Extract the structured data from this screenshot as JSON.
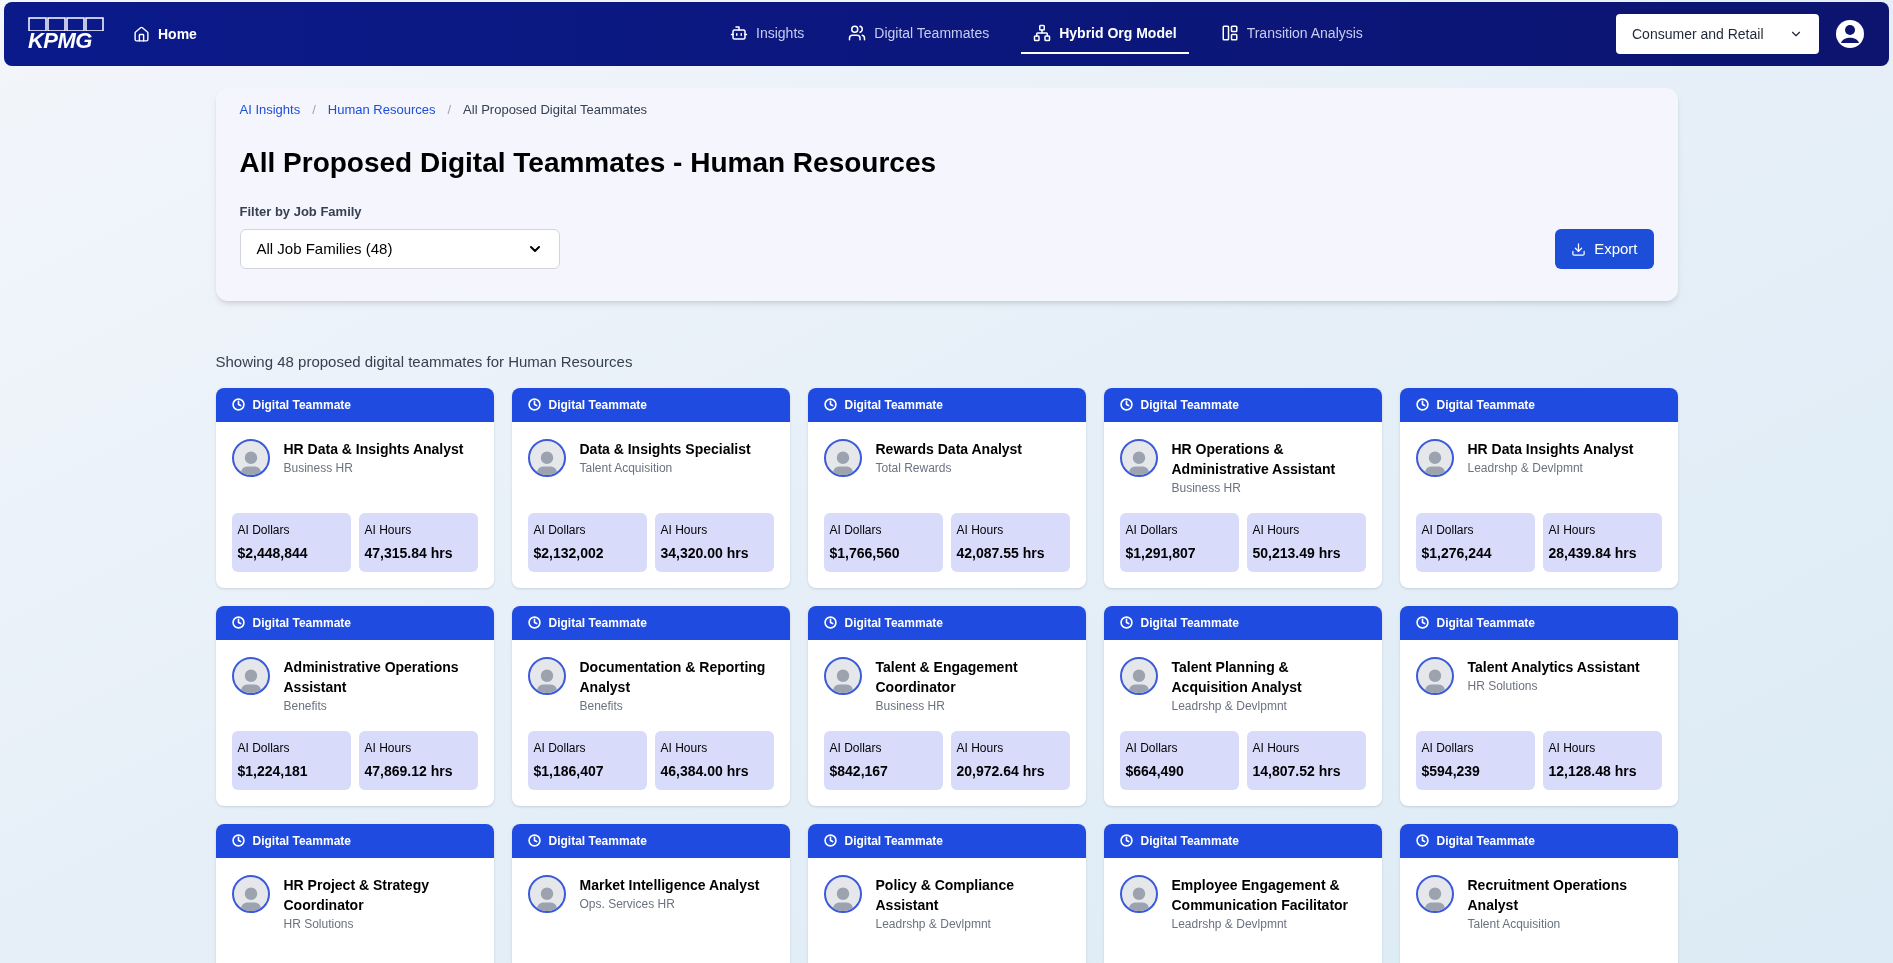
{
  "nav": {
    "logo": "KPMG",
    "home": {
      "label": "Home"
    },
    "tabs": [
      {
        "label": "Insights",
        "selected": false,
        "kind": "insights"
      },
      {
        "label": "Digital Teammates",
        "selected": false,
        "kind": "teammates"
      },
      {
        "label": "Hybrid Org Model",
        "selected": true,
        "kind": "org"
      },
      {
        "label": "Transition Analysis",
        "selected": false,
        "kind": "transition"
      }
    ],
    "industry_select": {
      "value": "Consumer and Retail"
    }
  },
  "breadcrumb": [
    {
      "label": "AI Insights",
      "kind": "link"
    },
    {
      "separator": "/",
      "label": "Human Resources",
      "kind": "link"
    },
    {
      "separator": "/",
      "label": "All Proposed Digital Teammates",
      "kind": "current"
    }
  ],
  "title": "All Proposed Digital Teammates - Human Resources",
  "filter": {
    "label": "Filter by Job Family",
    "value": "All Job Families (48)"
  },
  "export_button": "Export",
  "summary": "Showing 48 proposed digital teammates for Human Resources",
  "cards": [
    {
      "badge": "Digital Teammate",
      "title": "HR Data & Insights Analyst",
      "subtitle": "Business HR",
      "stats": [
        {
          "label": "AI Dollars",
          "value": "$2,448,844"
        },
        {
          "label": "AI Hours",
          "value": "47,315.84 hrs"
        }
      ]
    },
    {
      "badge": "Digital Teammate",
      "title": "Data & Insights Specialist",
      "subtitle": "Talent Acquisition",
      "stats": [
        {
          "label": "AI Dollars",
          "value": "$2,132,002"
        },
        {
          "label": "AI Hours",
          "value": "34,320.00 hrs"
        }
      ]
    },
    {
      "badge": "Digital Teammate",
      "title": "Rewards Data Analyst",
      "subtitle": "Total Rewards",
      "stats": [
        {
          "label": "AI Dollars",
          "value": "$1,766,560"
        },
        {
          "label": "AI Hours",
          "value": "42,087.55 hrs"
        }
      ]
    },
    {
      "badge": "Digital Teammate",
      "title": "HR Operations & Administrative Assistant",
      "subtitle": "Business HR",
      "stats": [
        {
          "label": "AI Dollars",
          "value": "$1,291,807"
        },
        {
          "label": "AI Hours",
          "value": "50,213.49 hrs"
        }
      ]
    },
    {
      "badge": "Digital Teammate",
      "title": "HR Data Insights Analyst",
      "subtitle": "Leadrshp & Devlpmnt",
      "stats": [
        {
          "label": "AI Dollars",
          "value": "$1,276,244"
        },
        {
          "label": "AI Hours",
          "value": "28,439.84 hrs"
        }
      ]
    },
    {
      "badge": "Digital Teammate",
      "title": "Administrative Operations Assistant",
      "subtitle": "Benefits",
      "stats": [
        {
          "label": "AI Dollars",
          "value": "$1,224,181"
        },
        {
          "label": "AI Hours",
          "value": "47,869.12 hrs"
        }
      ]
    },
    {
      "badge": "Digital Teammate",
      "title": "Documentation & Reporting Analyst",
      "subtitle": "Benefits",
      "stats": [
        {
          "label": "AI Dollars",
          "value": "$1,186,407"
        },
        {
          "label": "AI Hours",
          "value": "46,384.00 hrs"
        }
      ]
    },
    {
      "badge": "Digital Teammate",
      "title": "Talent & Engagement Coordinator",
      "subtitle": "Business HR",
      "stats": [
        {
          "label": "AI Dollars",
          "value": "$842,167"
        },
        {
          "label": "AI Hours",
          "value": "20,972.64 hrs"
        }
      ]
    },
    {
      "badge": "Digital Teammate",
      "title": "Talent Planning & Acquisition Analyst",
      "subtitle": "Leadrshp & Devlpmnt",
      "stats": [
        {
          "label": "AI Dollars",
          "value": "$664,490"
        },
        {
          "label": "AI Hours",
          "value": "14,807.52 hrs"
        }
      ]
    },
    {
      "badge": "Digital Teammate",
      "title": "Talent Analytics Assistant",
      "subtitle": "HR Solutions",
      "stats": [
        {
          "label": "AI Dollars",
          "value": "$594,239"
        },
        {
          "label": "AI Hours",
          "value": "12,128.48 hrs"
        }
      ]
    },
    {
      "badge": "Digital Teammate",
      "title": "HR Project & Strategy Coordinator",
      "subtitle": "HR Solutions"
    },
    {
      "badge": "Digital Teammate",
      "title": "Market Intelligence Analyst",
      "subtitle": "Ops. Services HR"
    },
    {
      "badge": "Digital Teammate",
      "title": "Policy & Compliance Assistant",
      "subtitle": "Leadrshp & Devlpmnt"
    },
    {
      "badge": "Digital Teammate",
      "title": "Employee Engagement & Communication Facilitator",
      "subtitle": "Leadrshp & Devlpmnt"
    },
    {
      "badge": "Digital Teammate",
      "title": "Recruitment Operations Analyst",
      "subtitle": "Talent Acquisition"
    }
  ]
}
